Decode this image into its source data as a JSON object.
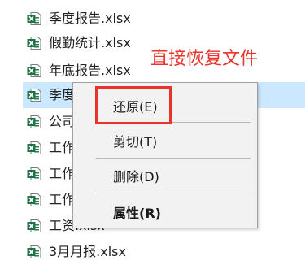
{
  "files": [
    {
      "name": "季度报告.xlsx",
      "icon": "excel-file-icon",
      "selected": false
    },
    {
      "name": "假勤统计.xlsx",
      "icon": "excel-file-icon",
      "selected": false
    },
    {
      "name": "年底报告.xlsx",
      "icon": "excel-file-icon",
      "selected": false
    },
    {
      "name": "季度",
      "icon": "excel-file-icon",
      "selected": true
    },
    {
      "name": "公司",
      "icon": "excel-file-icon",
      "selected": false
    },
    {
      "name": "工作",
      "icon": "excel-file-icon",
      "selected": false
    },
    {
      "name": "工作",
      "icon": "excel-file-icon",
      "selected": false
    },
    {
      "name": "工作",
      "icon": "excel-file-icon",
      "selected": false
    },
    {
      "name": "工资.xlsx",
      "icon": "excel-file-icon",
      "selected": false
    },
    {
      "name": "3月月报.xlsx",
      "icon": "excel-file-icon",
      "selected": false
    }
  ],
  "annotation": {
    "text": "直接恢复文件",
    "color": "#e8342c"
  },
  "context_menu": {
    "items": [
      {
        "label": "还原(E)",
        "bold": false,
        "highlighted": true
      },
      {
        "label": "剪切(T)",
        "bold": false,
        "highlighted": false
      },
      {
        "label": "删除(D)",
        "bold": false,
        "highlighted": false
      },
      {
        "label": "属性(R)",
        "bold": true,
        "highlighted": false
      }
    ]
  },
  "colors": {
    "selection": "#cce8ff",
    "excel_green": "#1e7145",
    "highlight_red": "#e8342c",
    "menu_background": "#f2f2f2"
  }
}
